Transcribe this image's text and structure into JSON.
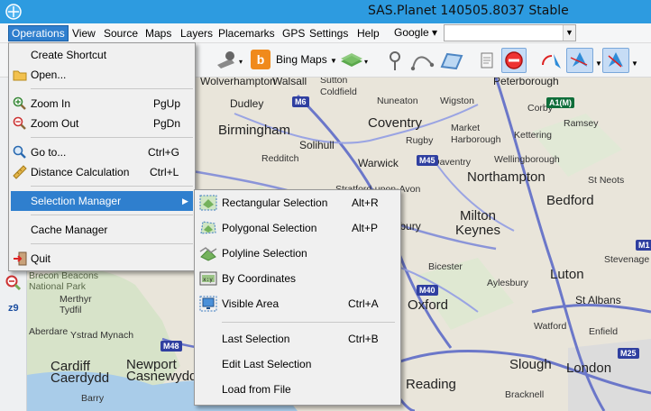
{
  "window": {
    "title": "SAS.Planet 140505.8037 Stable"
  },
  "menubar": {
    "items": [
      "Operations",
      "View",
      "Source",
      "Maps",
      "Layers",
      "Placemarks",
      "GPS",
      "Settings",
      "Help"
    ],
    "search_provider": "Google",
    "search_value": ""
  },
  "toolbar": {
    "map_source": "Bing Maps"
  },
  "sidebar": {
    "zoom_label": "z9"
  },
  "operations_menu": {
    "items": [
      {
        "label": "Create Shortcut",
        "shortcut": "",
        "icon": "none"
      },
      {
        "label": "Open...",
        "shortcut": "",
        "icon": "folder-icon"
      },
      {
        "label": "Zoom In",
        "shortcut": "PgUp",
        "icon": "zoom-in-icon"
      },
      {
        "label": "Zoom Out",
        "shortcut": "PgDn",
        "icon": "zoom-out-icon"
      },
      {
        "label": "Go to...",
        "shortcut": "Ctrl+G",
        "icon": "search-icon"
      },
      {
        "label": "Distance Calculation",
        "shortcut": "Ctrl+L",
        "icon": "ruler-icon"
      },
      {
        "label": "Selection Manager",
        "shortcut": "",
        "icon": "none"
      },
      {
        "label": "Cache Manager",
        "shortcut": "",
        "icon": "none"
      },
      {
        "label": "Quit",
        "shortcut": "",
        "icon": "quit-icon"
      }
    ]
  },
  "selection_menu": {
    "items": [
      {
        "label": "Rectangular Selection",
        "shortcut": "Alt+R",
        "icon": "rect-select-icon"
      },
      {
        "label": "Polygonal Selection",
        "shortcut": "Alt+P",
        "icon": "polygon-select-icon"
      },
      {
        "label": "Polyline Selection",
        "shortcut": "",
        "icon": "polyline-select-icon"
      },
      {
        "label": "By Coordinates",
        "shortcut": "",
        "icon": "coordinates-icon"
      },
      {
        "label": "Visible Area",
        "shortcut": "Ctrl+A",
        "icon": "monitor-icon"
      },
      {
        "label": "Last Selection",
        "shortcut": "Ctrl+B",
        "icon": "none"
      },
      {
        "label": "Edit Last Selection",
        "shortcut": "",
        "icon": "none"
      },
      {
        "label": "Load from File",
        "shortcut": "",
        "icon": "none"
      }
    ]
  },
  "map": {
    "places": [
      "Wolverhampton",
      "Walsall",
      "Sutton Coldfield",
      "Peterborough",
      "Dudley",
      "Nuneaton",
      "Wigston",
      "Corby",
      "Ramsey",
      "Birmingham",
      "Coventry",
      "Market Harborough",
      "Kettering",
      "Rugby",
      "Solihull",
      "Warwick",
      "Wellingborough",
      "Redditch",
      "Daventry",
      "Northampton",
      "St Neots",
      "Stratford-upon-Avon",
      "Bedford",
      "Banbury",
      "Milton Keynes",
      "Bicester",
      "Luton",
      "Aylesbury",
      "Stevenage",
      "St Albans",
      "Oxford",
      "Watford",
      "Enfield",
      "Slough",
      "London",
      "Reading",
      "Bracknell",
      "Newport Casnewydd",
      "Cardiff Caerdydd",
      "Merthyr Tydfil",
      "Aberdare",
      "Barry",
      "Ystrad Mynach",
      "Brecon Beacons National Park"
    ],
    "roads": [
      "M6",
      "M45",
      "M1",
      "M40",
      "M25",
      "M48",
      "A1(M)"
    ]
  }
}
